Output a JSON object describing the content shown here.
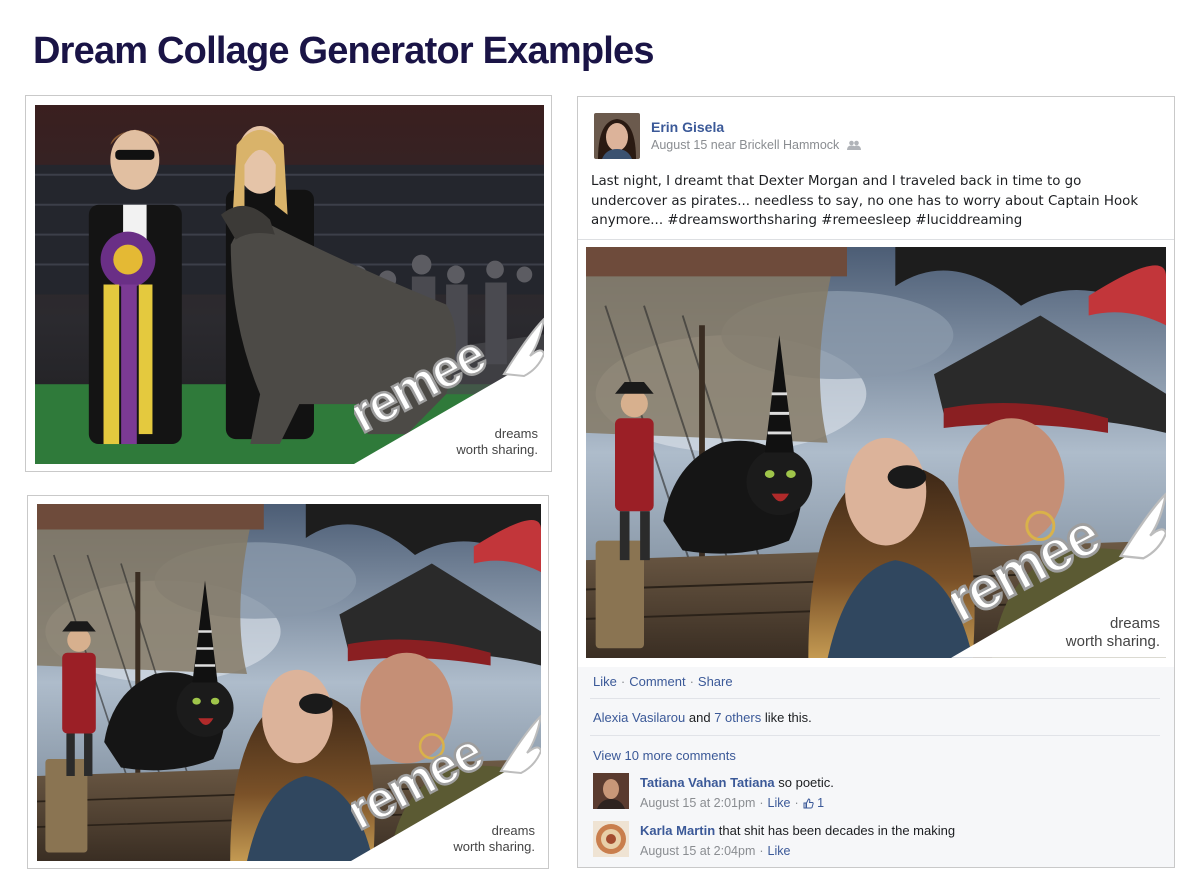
{
  "page": {
    "title": "Dream Collage Generator Examples"
  },
  "brand": {
    "logo_text": "remee",
    "tagline_line1": "dreams",
    "tagline_line2": "worth sharing."
  },
  "colors": {
    "title": "#1a1446",
    "fb_link": "#3b5998",
    "meta_gray": "#8a8d91",
    "logo_gray": "#b9b9b9"
  },
  "post": {
    "author": "Erin Gisela",
    "meta": "August 15 near Brickell Hammock",
    "text": "Last night, I dreamt that Dexter Morgan and I traveled back in time to go undercover as pirates... needless to say, no one has to worry about Captain Hook anymore... #dreamsworthsharing #remeesleep #luciddreaming",
    "actions": {
      "like": "Like",
      "comment": "Comment",
      "share": "Share",
      "separator": "·"
    },
    "likes": {
      "names": "Alexia Vasilarou",
      "connector": "and",
      "others": "7 others",
      "suffix": "like this."
    },
    "view_more": "View 10 more comments",
    "comments": [
      {
        "author": "Tatiana Vahan Tatiana",
        "text": "so poetic.",
        "time": "August 15 at 2:01pm",
        "like": "Like",
        "like_count": "1"
      },
      {
        "author": "Karla Martin",
        "text": "that shit has been decades in the making",
        "time": "August 15 at 2:04pm",
        "like": "Like"
      }
    ]
  }
}
